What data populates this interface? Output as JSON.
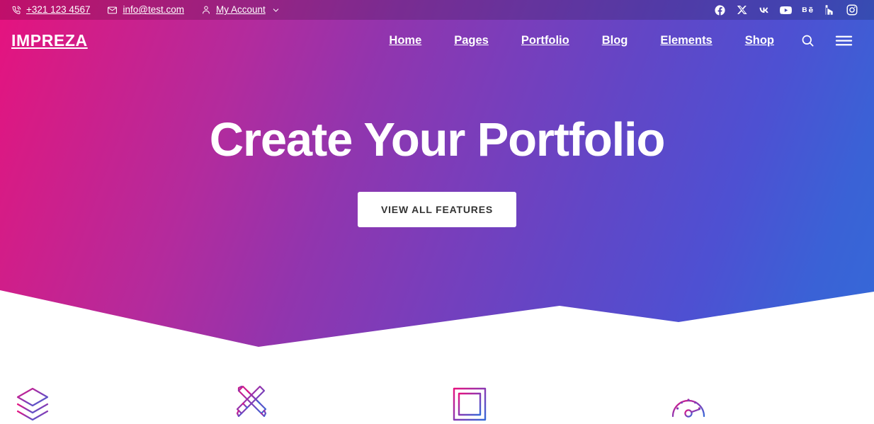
{
  "site": {
    "brand": "IMPREZA",
    "accent_left": "#e6127f",
    "accent_mid": "#7b3dba",
    "accent_right": "#3569d8"
  },
  "topbar": {
    "phone": "+321 123 4567",
    "phone_icon": "phone-icon",
    "email": "info@test.com",
    "email_icon": "envelope-icon",
    "account": "My Account",
    "account_icon": "user-icon",
    "account_caret": "chevron-down-icon",
    "social": [
      {
        "name": "facebook-icon",
        "label": "Facebook"
      },
      {
        "name": "x-twitter-icon",
        "label": "X"
      },
      {
        "name": "vk-icon",
        "label": "VK"
      },
      {
        "name": "youtube-icon",
        "label": "YouTube"
      },
      {
        "name": "behance-icon",
        "label": "Behance"
      },
      {
        "name": "houzz-icon",
        "label": "Houzz"
      },
      {
        "name": "instagram-icon",
        "label": "Instagram"
      }
    ]
  },
  "nav": {
    "links": [
      {
        "label": "Home"
      },
      {
        "label": "Pages"
      },
      {
        "label": "Portfolio"
      },
      {
        "label": "Blog"
      },
      {
        "label": "Elements"
      },
      {
        "label": "Shop"
      }
    ],
    "search_icon": "search-icon",
    "menu_icon": "hamburger-menu-icon"
  },
  "hero": {
    "title": "Create Your Portfolio",
    "button_label": "VIEW ALL FEATURES"
  },
  "features": [
    {
      "icon": "layers-icon"
    },
    {
      "icon": "pencil-ruler-icon"
    },
    {
      "icon": "square-frame-icon"
    },
    {
      "icon": "speedometer-icon"
    }
  ]
}
